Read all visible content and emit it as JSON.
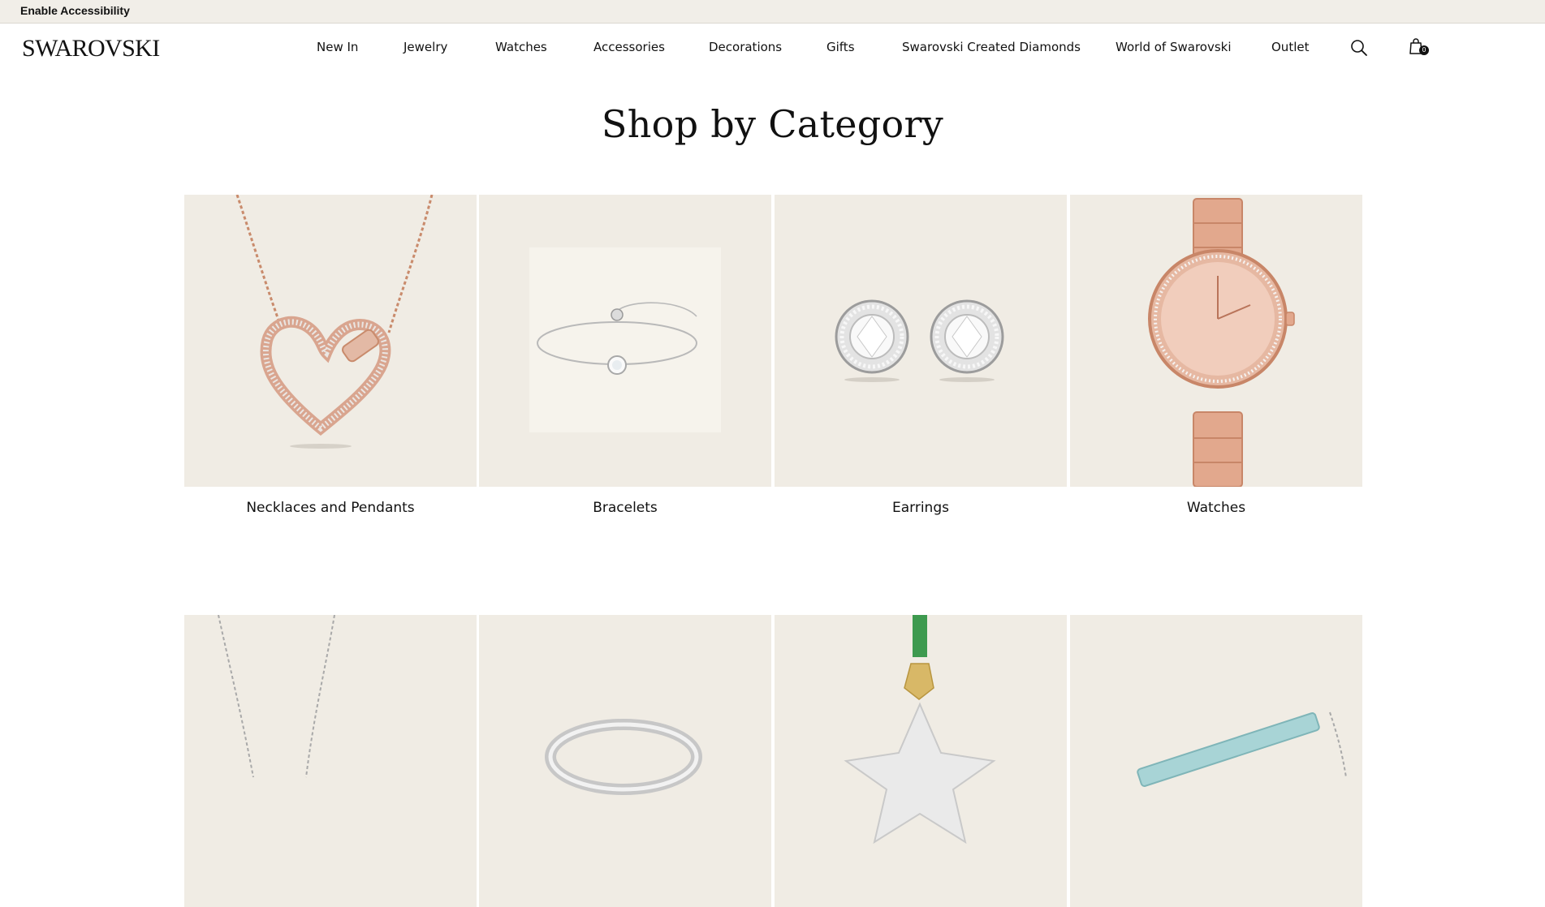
{
  "accessibility": {
    "label": "Enable Accessibility"
  },
  "header": {
    "logo": "SWAROVSKI",
    "nav": [
      "New In",
      "Jewelry",
      "Watches",
      "Accessories",
      "Decorations",
      "Gifts",
      "Swarovski Created Diamonds",
      "World of Swarovski",
      "Outlet"
    ],
    "icons": {
      "search": "search-icon",
      "cart": "shopping-bag-icon"
    },
    "cart_count": "0"
  },
  "main": {
    "title": "Shop by Category",
    "categories": [
      {
        "label": "Necklaces and Pendants",
        "icon": "heart-necklace-image"
      },
      {
        "label": "Bracelets",
        "icon": "bracelet-image"
      },
      {
        "label": "Earrings",
        "icon": "stud-earrings-image"
      },
      {
        "label": "Watches",
        "icon": "rose-gold-watch-image"
      }
    ],
    "categories_row2_icons": [
      "pendant-chain-image",
      "ring-image",
      "star-ornament-image",
      "bar-jewelry-image"
    ]
  },
  "colors": {
    "tile_bg": "#f0ece4",
    "topbar_bg": "#f1eee8",
    "rose_gold": "#d9a58f",
    "text": "#111111"
  }
}
